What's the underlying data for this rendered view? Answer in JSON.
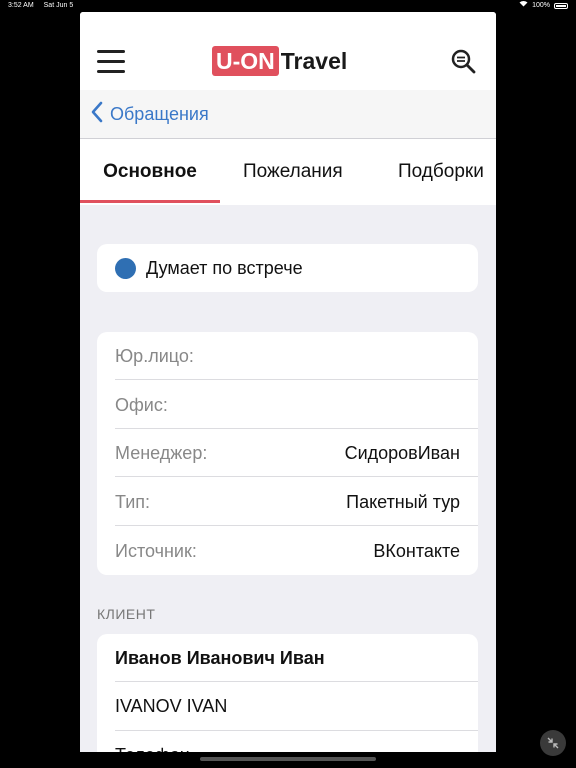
{
  "statusbar": {
    "time": "3:52 AM",
    "date": "Sat Jun 5",
    "battery": "100%"
  },
  "header": {
    "logo_box": "U-ON",
    "logo_text": "Travel"
  },
  "nav": {
    "back_label": "Обращения"
  },
  "tabs": [
    {
      "label": "Основное",
      "active": true
    },
    {
      "label": "Пожелания"
    },
    {
      "label": "Подборки"
    }
  ],
  "status": {
    "text": "Думает по встрече",
    "color": "#2f6fb3"
  },
  "info": {
    "rows": [
      {
        "label": "Юр.лицо:",
        "value": ""
      },
      {
        "label": "Офис:",
        "value": ""
      },
      {
        "label": "Менеджер:",
        "value": "СидоровИван"
      },
      {
        "label": "Тип:",
        "value": "Пакетный тур"
      },
      {
        "label": "Источник:",
        "value": "ВКонтакте"
      }
    ]
  },
  "client": {
    "section_title": "КЛИЕНТ",
    "name": "Иванов  Иванович  Иван",
    "latin_name": "IVANOV  IVAN",
    "phone_label": "Телефон"
  },
  "colors": {
    "accent": "#e0505d",
    "link": "#3a78c8"
  }
}
